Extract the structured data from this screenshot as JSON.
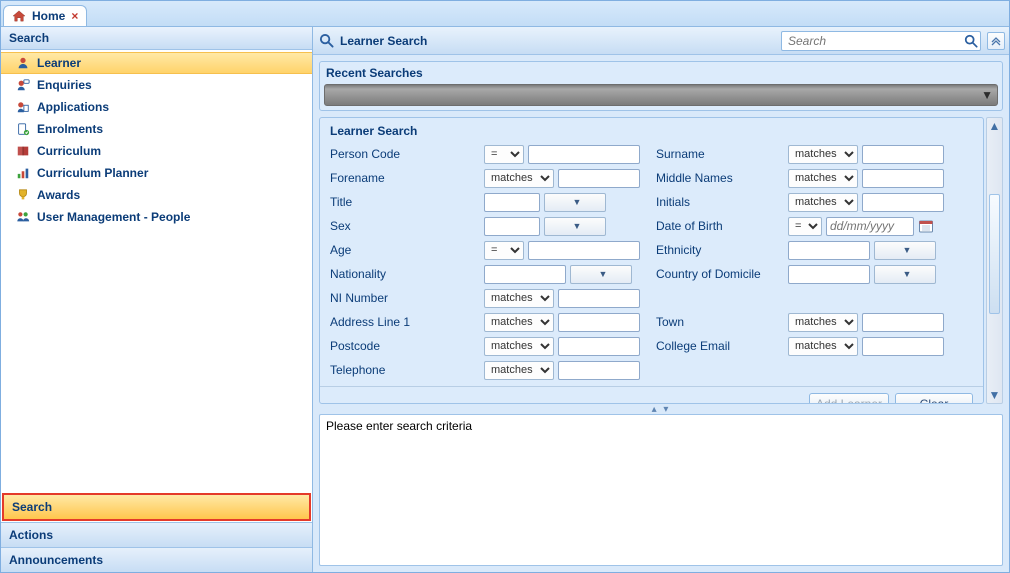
{
  "tab": {
    "title": "Home"
  },
  "left": {
    "header": "Search",
    "items": [
      {
        "id": "learner",
        "label": "Learner",
        "icon": "person-icon",
        "selected": true
      },
      {
        "id": "enquiries",
        "label": "Enquiries",
        "icon": "chat-person-icon"
      },
      {
        "id": "applications",
        "label": "Applications",
        "icon": "applications-icon"
      },
      {
        "id": "enrolments",
        "label": "Enrolments",
        "icon": "enrolment-icon"
      },
      {
        "id": "curriculum",
        "label": "Curriculum",
        "icon": "book-icon"
      },
      {
        "id": "curriculum-planner",
        "label": "Curriculum Planner",
        "icon": "planner-icon"
      },
      {
        "id": "awards",
        "label": "Awards",
        "icon": "award-icon"
      },
      {
        "id": "user-management",
        "label": "User Management - People",
        "icon": "people-icon"
      }
    ],
    "accordion": {
      "search": "Search",
      "actions": "Actions",
      "announcements": "Announcements"
    }
  },
  "header": {
    "title": "Learner Search",
    "search_placeholder": "Search"
  },
  "recent": {
    "label": "Recent Searches"
  },
  "criteria": {
    "group": "Learner Search",
    "person_code": {
      "label": "Person Code",
      "op": "=",
      "value": ""
    },
    "surname": {
      "label": "Surname",
      "op": "matches",
      "value": ""
    },
    "forename": {
      "label": "Forename",
      "op": "matches",
      "value": ""
    },
    "middle": {
      "label": "Middle Names",
      "op": "matches",
      "value": ""
    },
    "title": {
      "label": "Title",
      "value": ""
    },
    "initials": {
      "label": "Initials",
      "op": "matches",
      "value": ""
    },
    "sex": {
      "label": "Sex",
      "value": ""
    },
    "dob": {
      "label": "Date of Birth",
      "op": "=",
      "placeholder": "dd/mm/yyyy"
    },
    "age": {
      "label": "Age",
      "op": "=",
      "value": ""
    },
    "ethnicity": {
      "label": "Ethnicity",
      "value": ""
    },
    "nationality": {
      "label": "Nationality",
      "value": ""
    },
    "country": {
      "label": "Country of Domicile",
      "value": ""
    },
    "ni": {
      "label": "NI Number",
      "op": "matches",
      "value": ""
    },
    "addr1": {
      "label": "Address Line 1",
      "op": "matches",
      "value": ""
    },
    "town": {
      "label": "Town",
      "op": "matches",
      "value": ""
    },
    "postcode": {
      "label": "Postcode",
      "op": "matches",
      "value": ""
    },
    "email": {
      "label": "College Email",
      "op": "matches",
      "value": ""
    },
    "telephone": {
      "label": "Telephone",
      "op": "matches",
      "value": ""
    }
  },
  "buttons": {
    "add": "Add Learner",
    "clear": "Clear"
  },
  "results": {
    "message": "Please enter search criteria"
  }
}
